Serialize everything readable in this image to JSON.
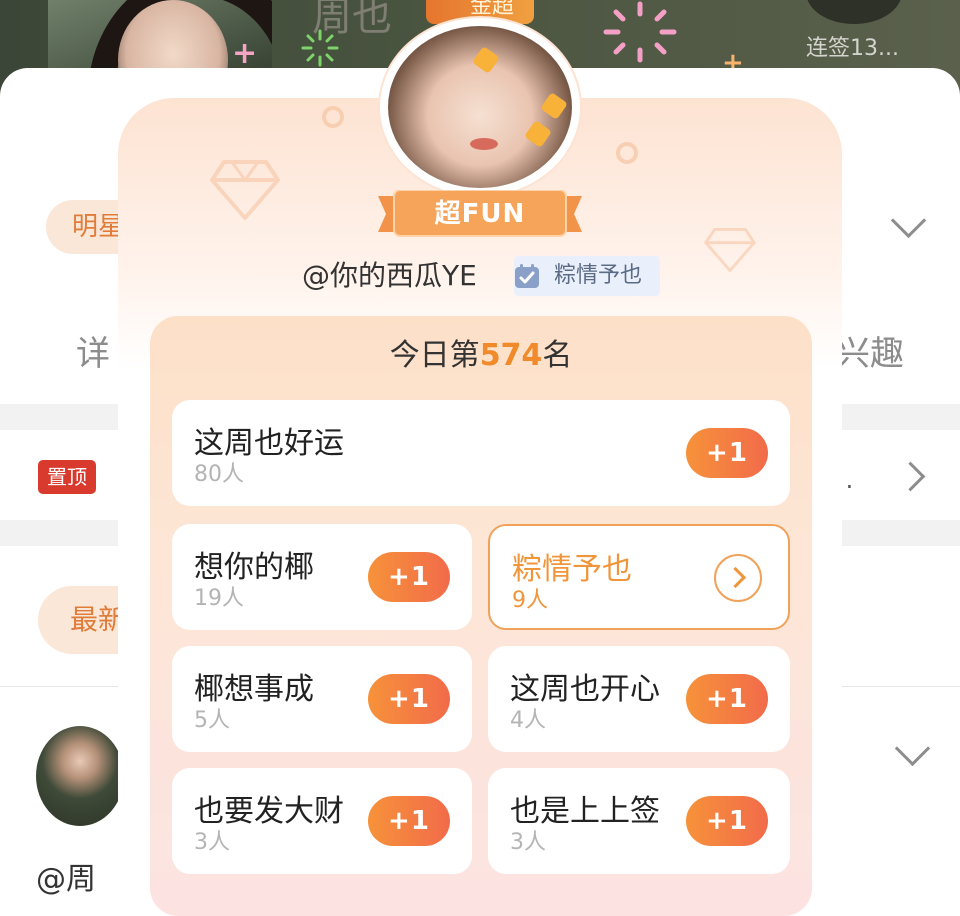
{
  "background": {
    "header": {
      "name": "周也",
      "badge": "金超",
      "signin": "连签13..."
    },
    "tag": "明星",
    "detail": "详",
    "interest": "兴趣",
    "pinned": "置顶",
    "ellipsis": "..",
    "latest": "最新",
    "mention": "@周"
  },
  "popup": {
    "ribbon": "超FUN",
    "username": "@你的西瓜YE",
    "verified_tag": "粽情予也",
    "rank": {
      "prefix": "今日第",
      "number": "574",
      "suffix": "名"
    },
    "options": [
      {
        "name": "这周也好运",
        "count": "80人",
        "action": "+1"
      },
      {
        "name": "想你的椰",
        "count": "19人",
        "action": "+1"
      },
      {
        "name": "粽情予也",
        "count": "9人",
        "action": "arrow"
      },
      {
        "name": "椰想事成",
        "count": "5人",
        "action": "+1"
      },
      {
        "name": "这周也开心",
        "count": "4人",
        "action": "+1"
      },
      {
        "name": "也要发大财",
        "count": "3人",
        "action": "+1"
      },
      {
        "name": "也是上上签",
        "count": "3人",
        "action": "+1"
      }
    ]
  },
  "colors": {
    "accent_orange": "#f08a2a",
    "button_gradient_start": "#f6923a",
    "button_gradient_end": "#f26b4a",
    "pinned_red": "#d93a2e"
  },
  "icons": [
    "verified-icon",
    "chevron-right-icon",
    "chevron-down-icon",
    "diamond-icon",
    "sparkle-icon"
  ]
}
